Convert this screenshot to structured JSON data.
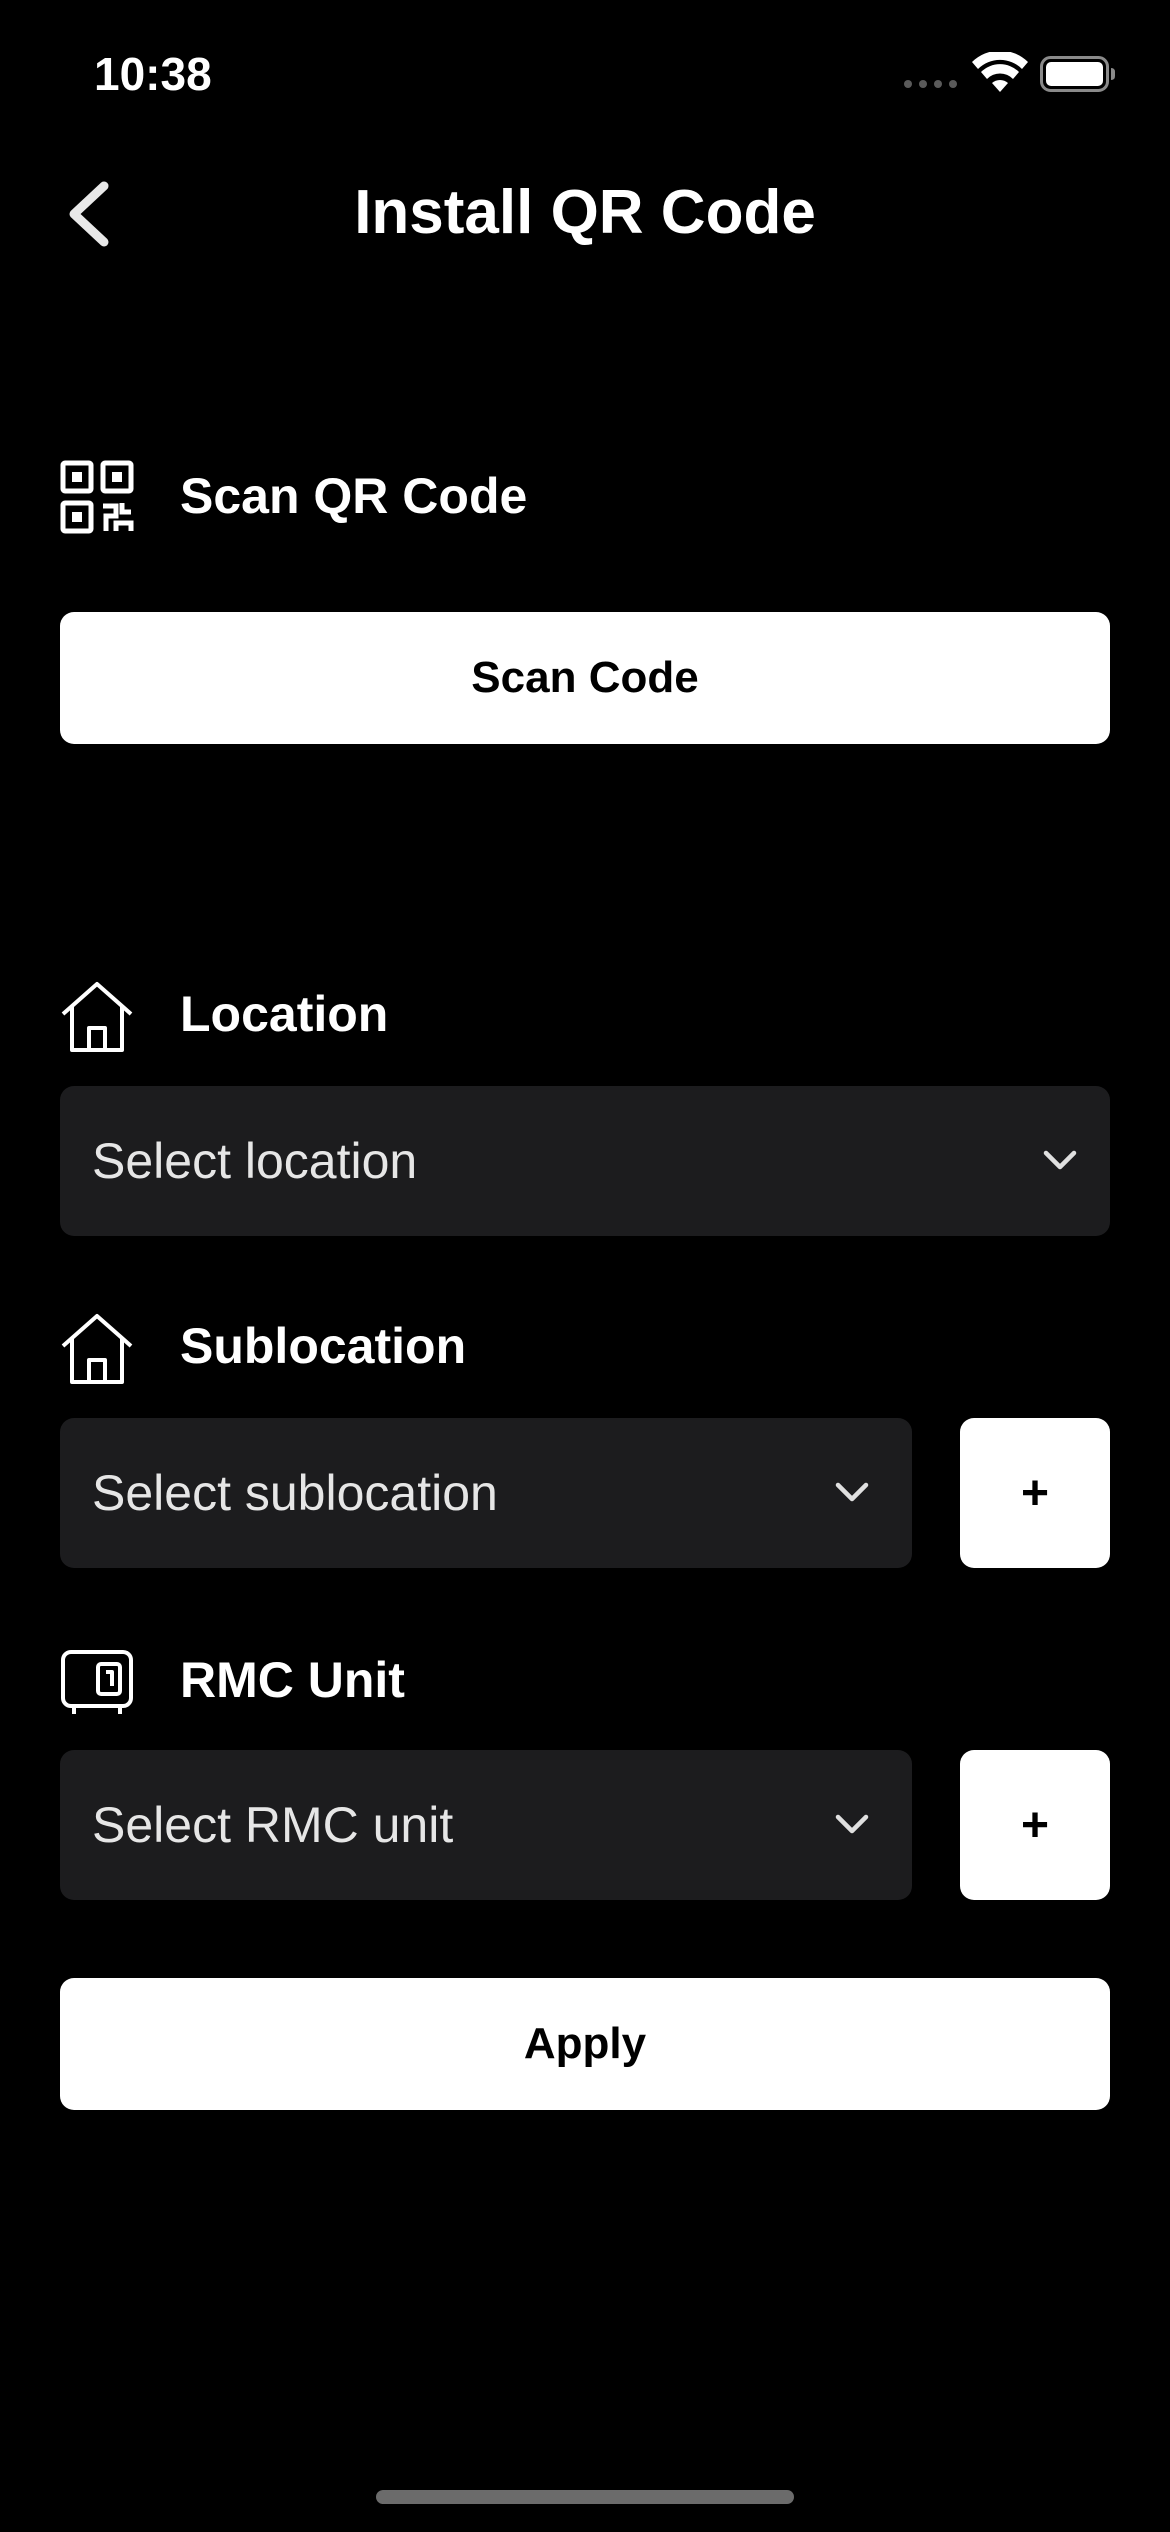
{
  "status_bar": {
    "time": "10:38"
  },
  "nav": {
    "title": "Install QR Code",
    "back_icon": "chevron-left-icon"
  },
  "scan_section": {
    "icon": "qr-code-icon",
    "label": "Scan QR Code",
    "button_label": "Scan Code"
  },
  "location_section": {
    "icon": "house-icon",
    "label": "Location",
    "placeholder": "Select location"
  },
  "sublocation_section": {
    "icon": "house-icon",
    "label": "Sublocation",
    "placeholder": "Select sublocation",
    "add_label": "+"
  },
  "rmc_section": {
    "icon": "rmc-unit-icon",
    "label": "RMC Unit",
    "placeholder": "Select RMC unit",
    "add_label": "+"
  },
  "apply_label": "Apply",
  "colors": {
    "background": "#000000",
    "field_bg": "#1c1c1e",
    "button_bg": "#ffffff",
    "text": "#ffffff"
  }
}
